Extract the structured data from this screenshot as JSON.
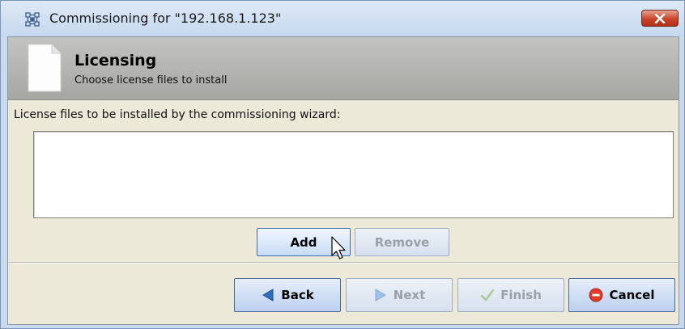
{
  "window": {
    "title": "Commissioning for \"192.168.1.123\""
  },
  "header": {
    "title": "Licensing",
    "subtitle": "Choose license files to install"
  },
  "content": {
    "instruction": "License files to be installed by the commissioning wizard:",
    "license_files": []
  },
  "buttons": {
    "add": "Add",
    "remove": "Remove",
    "back": "Back",
    "next": "Next",
    "finish": "Finish",
    "cancel": "Cancel"
  },
  "icons": {
    "app": "network-grid-icon",
    "close": "close-icon",
    "page": "blank-page-icon",
    "back": "arrow-left-icon",
    "next": "arrow-right-icon",
    "finish": "checkmark-icon",
    "cancel": "stop-icon"
  },
  "colors": {
    "accent": "#2d6fc0",
    "close_red": "#c8452c",
    "cancel_red": "#e03c2c"
  }
}
